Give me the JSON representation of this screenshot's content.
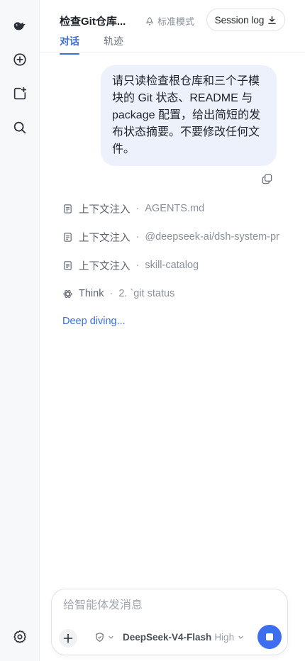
{
  "header": {
    "title": "检查Git仓库...",
    "mode_label": "标准模式",
    "session_log_label": "Session log",
    "tabs": [
      {
        "label": "对话",
        "active": true
      },
      {
        "label": "轨迹",
        "active": false
      }
    ]
  },
  "sidebar": {
    "icons": [
      "whale-logo-icon",
      "new-chat-icon",
      "add-agent-icon",
      "search-icon",
      "settings-icon"
    ]
  },
  "conversation": {
    "user_message": "请只读检查根仓库和三个子模块的 Git 状态、README 与 package 配置，给出简短的发布状态摘要。不要修改任何文件。",
    "steps": [
      {
        "icon": "document-icon",
        "label": "上下文注入",
        "value": "AGENTS.md"
      },
      {
        "icon": "document-icon",
        "label": "上下文注入",
        "value": "@deepseek-ai/dsh-system-pr"
      },
      {
        "icon": "document-icon",
        "label": "上下文注入",
        "value": "skill-catalog"
      },
      {
        "icon": "think-icon",
        "label": "Think",
        "value": "2. `git status"
      }
    ],
    "status_text": "Deep diving..."
  },
  "composer": {
    "placeholder": "给智能体发消息",
    "model_name": "DeepSeek-V4-Flash",
    "effort_level": "High"
  },
  "colors": {
    "accent": "#3b6fd8",
    "send_button": "#3d6ef0",
    "user_bubble": "#edf1fc",
    "rail_bg": "#f7f8fa"
  }
}
